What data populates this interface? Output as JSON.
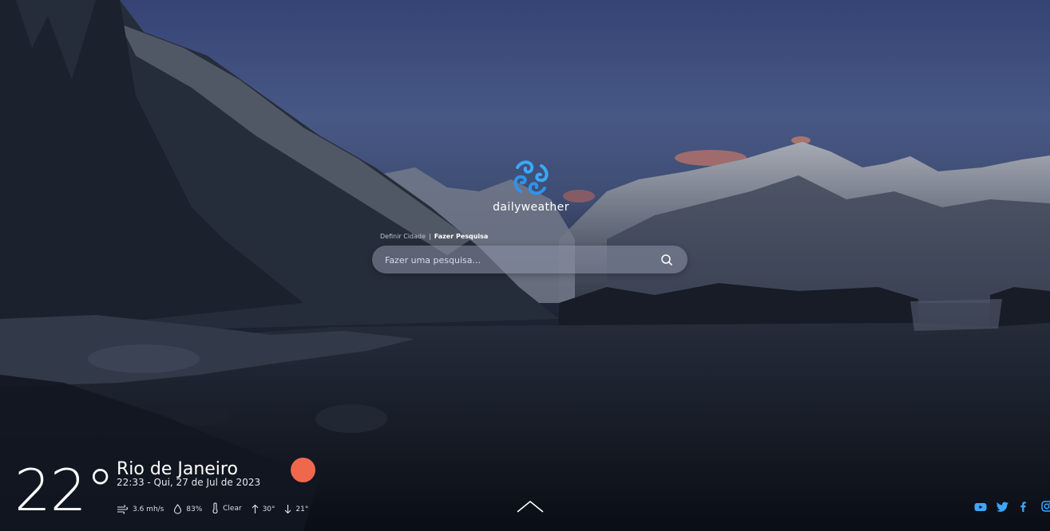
{
  "brand": {
    "name": "dailyweather"
  },
  "search": {
    "link_city": "Definir Cidade",
    "separator": "|",
    "link_search": "Fazer Pesquisa",
    "placeholder": "Fazer uma pesquisa..."
  },
  "weather": {
    "temperature": "22°",
    "city": "Rio de Janeiro",
    "datetime": "22:33 - Qui, 27 de Jul de 2023",
    "wind": "3.6 mh/s",
    "humidity": "83%",
    "condition": "Clear",
    "max": "30°",
    "min": "21°"
  },
  "colors": {
    "sun_indicator": "#f0684c",
    "accent_blue": "#3aa8ff"
  },
  "icons": {
    "scroll_up": "chevron-up-icon",
    "social": [
      "youtube-icon",
      "twitter-icon",
      "facebook-icon",
      "instagram-icon"
    ]
  }
}
